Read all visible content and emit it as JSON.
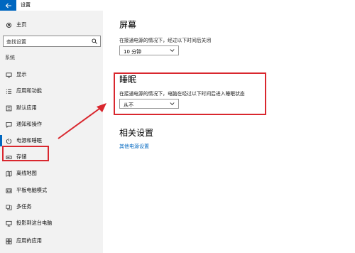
{
  "window": {
    "title": "设置"
  },
  "sidebar": {
    "home_label": "主页",
    "search_placeholder": "查找设置",
    "section_label": "系统",
    "items": [
      {
        "label": "显示",
        "icon": "monitor-icon"
      },
      {
        "label": "应用和功能",
        "icon": "list-icon"
      },
      {
        "label": "默认应用",
        "icon": "default-apps-icon"
      },
      {
        "label": "通知和操作",
        "icon": "notification-icon"
      },
      {
        "label": "电源和睡眠",
        "icon": "power-icon",
        "active": true
      },
      {
        "label": "存储",
        "icon": "storage-icon"
      },
      {
        "label": "离线地图",
        "icon": "map-icon"
      },
      {
        "label": "平板电脑模式",
        "icon": "tablet-icon"
      },
      {
        "label": "多任务",
        "icon": "multitask-icon"
      },
      {
        "label": "投影到这台电脑",
        "icon": "project-icon"
      },
      {
        "label": "应用的应用",
        "icon": "apps-icon"
      }
    ]
  },
  "main": {
    "screen": {
      "heading": "屏幕",
      "description": "在接通电源的情况下，经过以下时间后关闭",
      "dropdown_value": "10 分钟"
    },
    "sleep": {
      "heading": "睡眠",
      "description": "在接通电源的情况下，电脑在经过以下时间后进入睡眠状态",
      "dropdown_value": "从不"
    },
    "related": {
      "heading": "相关设置",
      "link": "其他电源设置"
    }
  },
  "colors": {
    "accent": "#0067c0",
    "annotation_red": "#d9272e",
    "sidebar_bg": "#f2f2f2"
  }
}
